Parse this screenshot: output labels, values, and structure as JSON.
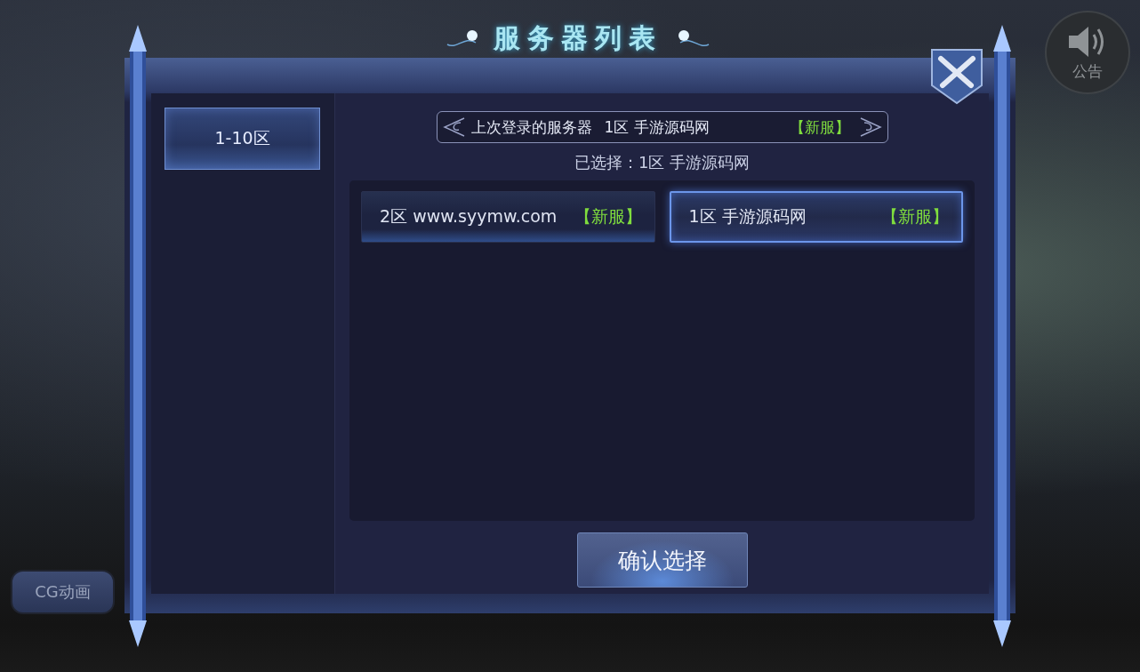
{
  "title": "服务器列表",
  "announcement_button": {
    "label": "公告"
  },
  "cg_button": {
    "label": "CG动画"
  },
  "zone_tabs": [
    {
      "label": "1-10区",
      "selected": true
    }
  ],
  "last_login": {
    "label": "上次登录的服务器",
    "server": "1区 手游源码网",
    "tag": "【新服】"
  },
  "selection": "已选择：1区 手游源码网",
  "servers": [
    {
      "name": "2区 www.syymw.com",
      "tag": "【新服】",
      "selected": false
    },
    {
      "name": "1区 手游源码网",
      "tag": "【新服】",
      "selected": true
    }
  ],
  "confirm_button": "确认选择"
}
